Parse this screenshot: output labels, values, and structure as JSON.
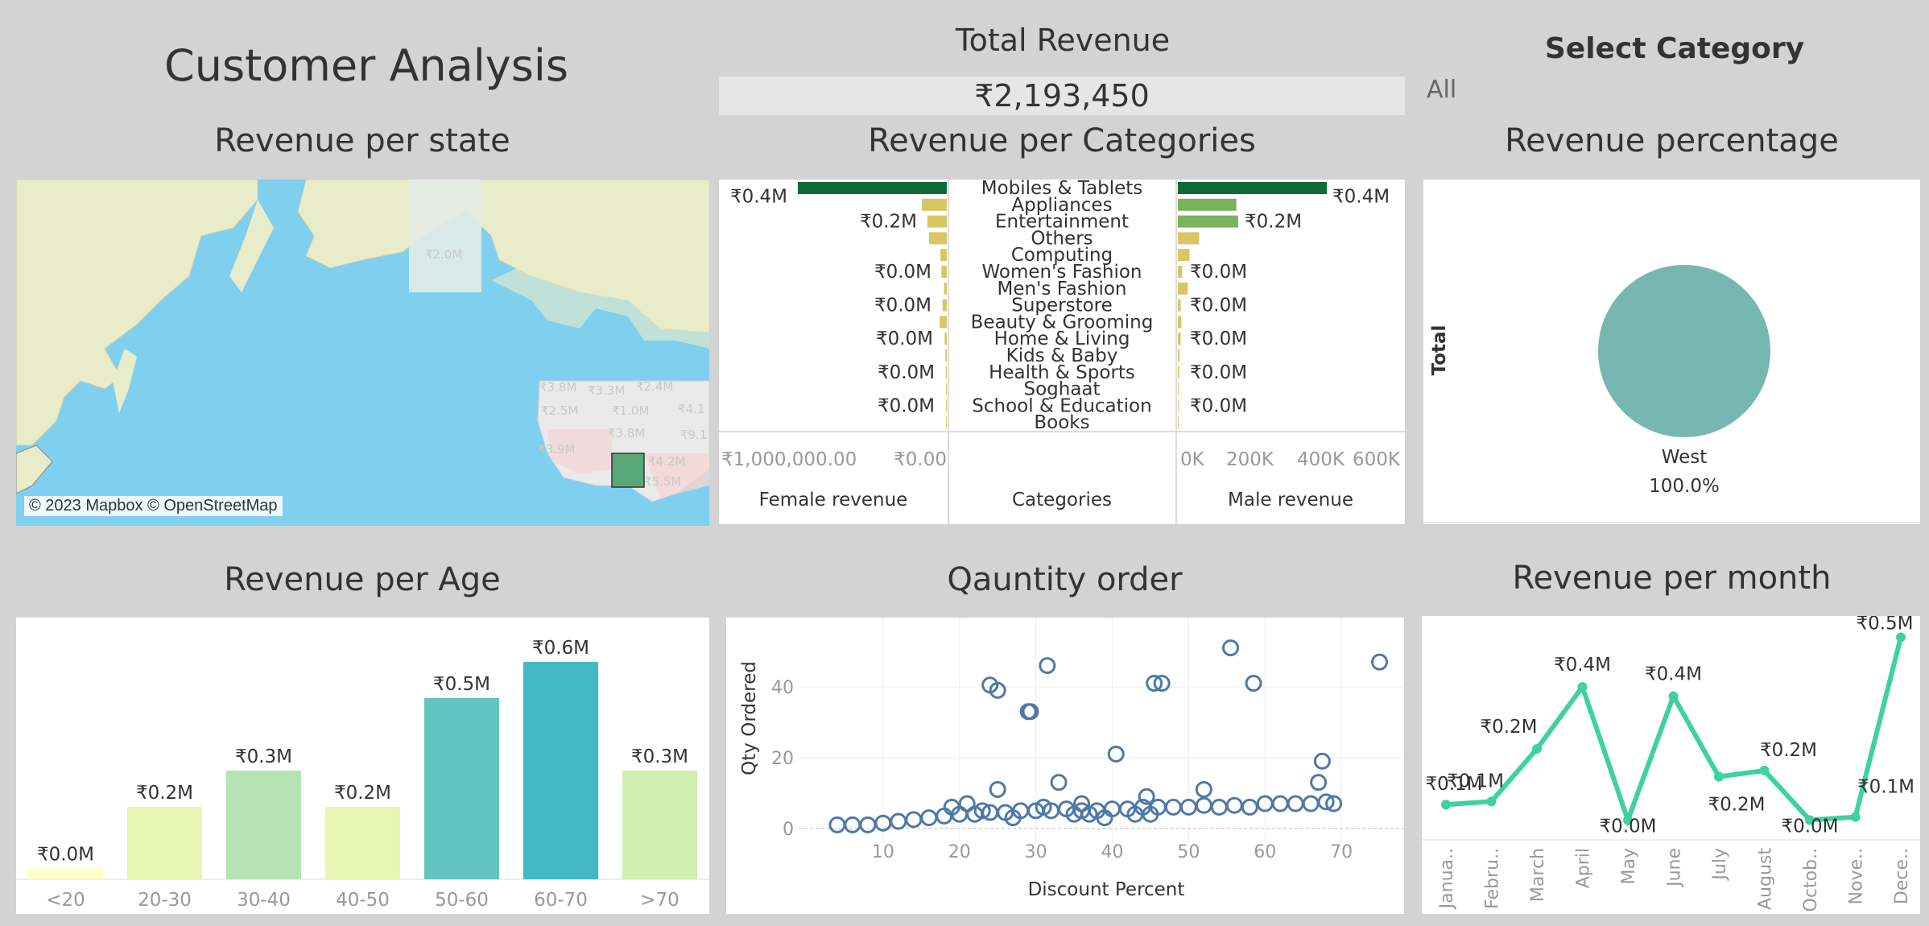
{
  "header": {
    "title": "Customer Analysis",
    "total_revenue_label": "Total Revenue",
    "total_revenue_value": "₹2,193,450",
    "select_category_label": "Select Category",
    "select_category_value": "All"
  },
  "map_panel": {
    "title": "Revenue per state",
    "attribution": "© 2023 Mapbox © OpenStreetMap",
    "state_labels": [
      "₹2.0M",
      "₹3.8M",
      "₹3.3M",
      "₹2.4M",
      "₹2.5M",
      "₹1.0M",
      "₹4.1",
      "₹3.8M",
      "₹9.1",
      "₹3.9M",
      "₹4.2M",
      "₹5.5M"
    ],
    "colors": {
      "water": "#7fcfef",
      "land": "#e9ecc8",
      "highlight": "#5aa77a"
    }
  },
  "categories_panel": {
    "title": "Revenue per Categories",
    "left_header": "Female revenue",
    "center_header": "Categories",
    "right_header": "Male revenue",
    "left_axis_ticks": [
      "₹1,000,000.00",
      "₹0.00"
    ],
    "right_axis_ticks": [
      "0K",
      "200K",
      "400K",
      "600K"
    ],
    "female_labels": [
      "₹0.4M",
      "₹0.2M",
      "₹0.0M",
      "₹0.0M",
      "₹0.0M",
      "₹0.0M",
      "₹0.0M"
    ],
    "male_labels": [
      "₹0.4M",
      "₹0.2M",
      "₹0.0M",
      "₹0.0M",
      "₹0.0M",
      "₹0.0M",
      "₹0.0M"
    ]
  },
  "pie_panel": {
    "title": "Revenue percentage",
    "row_label": "Total",
    "slice_label": "West",
    "slice_percent": "100.0%",
    "color": "#76b7b2"
  },
  "age_panel": {
    "title": "Revenue per Age"
  },
  "scatter_panel": {
    "title": "Qauntity order"
  },
  "month_panel": {
    "title": "Revenue per month"
  },
  "chart_data": [
    {
      "type": "bar",
      "orientation": "horizontal",
      "name": "Revenue per Categories",
      "categories": [
        "Mobiles & Tablets",
        "Appliances",
        "Entertainment",
        "Others",
        "Computing",
        "Women's Fashion",
        "Men's Fashion",
        "Superstore",
        "Beauty & Grooming",
        "Home & Living",
        "Kids & Baby",
        "Health & Sports",
        "Soghaat",
        "School & Education",
        "Books"
      ],
      "series": [
        {
          "name": "Female revenue",
          "values": [
            420000,
            70000,
            55000,
            50000,
            18000,
            15000,
            8000,
            12000,
            20000,
            6000,
            4000,
            3000,
            1500,
            500,
            200
          ]
        },
        {
          "name": "Male revenue",
          "values": [
            420000,
            165000,
            170000,
            60000,
            33000,
            12000,
            28000,
            8000,
            10000,
            8000,
            5000,
            4000,
            1500,
            500,
            200
          ]
        }
      ],
      "xlim": [
        0,
        600000
      ]
    },
    {
      "type": "pie",
      "name": "Revenue percentage",
      "categories": [
        "West"
      ],
      "values": [
        100.0
      ]
    },
    {
      "type": "bar",
      "name": "Revenue per Age",
      "categories": [
        "<20",
        "20-30",
        "30-40",
        "40-50",
        "50-60",
        "60-70",
        ">70"
      ],
      "values": [
        0.03,
        0.2,
        0.3,
        0.2,
        0.5,
        0.6,
        0.3
      ],
      "labels": [
        "₹0.0M",
        "₹0.2M",
        "₹0.3M",
        "₹0.2M",
        "₹0.5M",
        "₹0.6M",
        "₹0.3M"
      ],
      "colors": [
        "#ffffcc",
        "#e8f6b1",
        "#b5e3b3",
        "#e8f6b1",
        "#63c4c0",
        "#42b8c4",
        "#cfeeb0"
      ],
      "ylim": [
        0,
        0.6
      ]
    },
    {
      "type": "scatter",
      "name": "Qauntity order",
      "xlabel": "Discount Percent",
      "ylabel": "Qty Ordered",
      "x_ticks": [
        10,
        20,
        30,
        40,
        50,
        60,
        70
      ],
      "y_ticks": [
        0,
        20,
        40
      ],
      "xlim": [
        0,
        78
      ],
      "ylim": [
        -3,
        55
      ],
      "points": [
        [
          24,
          40.5
        ],
        [
          25,
          39
        ],
        [
          29,
          33
        ],
        [
          29.3,
          33
        ],
        [
          31.5,
          46
        ],
        [
          55.5,
          51
        ],
        [
          45.5,
          41
        ],
        [
          46.5,
          41
        ],
        [
          58.5,
          41
        ],
        [
          75,
          47
        ],
        [
          40.5,
          21
        ],
        [
          67.5,
          19
        ],
        [
          25,
          11
        ],
        [
          33,
          13
        ],
        [
          52,
          11
        ],
        [
          67,
          13
        ],
        [
          44.5,
          9
        ],
        [
          36,
          7
        ],
        [
          4,
          1
        ],
        [
          6,
          1
        ],
        [
          8,
          1
        ],
        [
          10,
          1.5
        ],
        [
          12,
          2
        ],
        [
          14,
          2.5
        ],
        [
          16,
          3
        ],
        [
          18,
          3.5
        ],
        [
          20,
          4
        ],
        [
          22,
          4
        ],
        [
          24,
          4.5
        ],
        [
          26,
          4.5
        ],
        [
          28,
          5
        ],
        [
          30,
          5
        ],
        [
          32,
          5
        ],
        [
          34,
          5.5
        ],
        [
          36,
          5
        ],
        [
          38,
          5
        ],
        [
          40,
          5.5
        ],
        [
          42,
          5.5
        ],
        [
          44,
          6
        ],
        [
          46,
          6
        ],
        [
          48,
          6
        ],
        [
          50,
          6
        ],
        [
          52,
          6.5
        ],
        [
          54,
          6
        ],
        [
          56,
          6.5
        ],
        [
          58,
          6
        ],
        [
          60,
          7
        ],
        [
          62,
          7
        ],
        [
          64,
          7
        ],
        [
          66,
          7
        ],
        [
          68,
          7.5
        ],
        [
          69,
          7
        ],
        [
          19,
          6
        ],
        [
          21,
          7
        ],
        [
          23,
          5
        ],
        [
          27,
          3
        ],
        [
          31,
          6
        ],
        [
          35,
          4
        ],
        [
          37,
          4
        ],
        [
          39,
          3
        ],
        [
          43,
          4
        ],
        [
          45,
          4
        ]
      ]
    },
    {
      "type": "line",
      "name": "Revenue per month",
      "categories": [
        "Janua..",
        "Febru..",
        "March",
        "April",
        "May",
        "June",
        "July",
        "August",
        "Octob..",
        "Nove..",
        "Dece.."
      ],
      "values": [
        0.08,
        0.09,
        0.26,
        0.46,
        0.03,
        0.43,
        0.17,
        0.19,
        0.03,
        0.04,
        0.62
      ],
      "labels": [
        "₹0.1M",
        "₹0.1M",
        "₹0.2M",
        "₹0.4M",
        "₹0.0M",
        "₹0.4M",
        "₹0.2M",
        "₹0.2M",
        "₹0.0M",
        "₹0.1M",
        "₹0.5M"
      ],
      "ylim": [
        0,
        0.65
      ],
      "color": "#3fd19f"
    }
  ]
}
